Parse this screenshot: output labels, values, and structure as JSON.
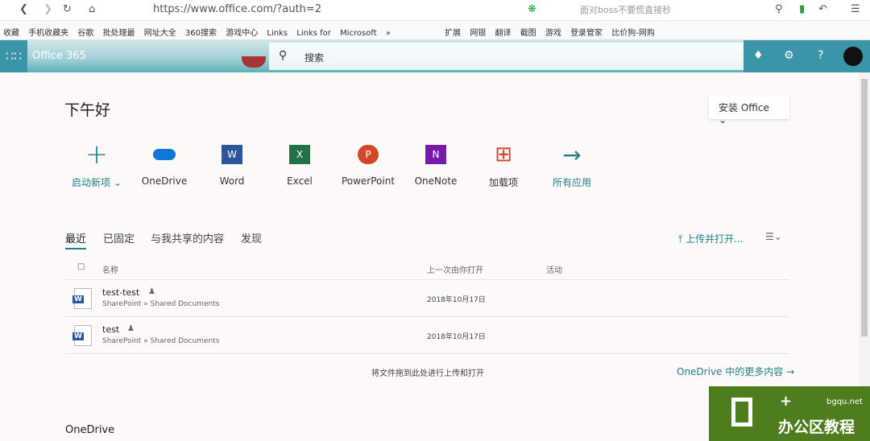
{
  "browser": {
    "url": "https://www.office.com/?auth=2",
    "search_placeholder": "面对boss不要慌直接秒",
    "bookmarks": [
      "收藏",
      "手机收藏夹",
      "谷歌",
      "批处理最",
      "网址大全",
      "360搜索",
      "游戏中心",
      "Links",
      "Links for",
      "Microsoft",
      "»",
      "扩展",
      "网银",
      "翻译",
      "截图",
      "游戏",
      "登录管家",
      "比价狗-网购"
    ]
  },
  "header": {
    "brand": "Office 365",
    "search_placeholder": "搜索"
  },
  "main": {
    "greeting": "下午好",
    "install_label": "安装 Office",
    "apps": [
      {
        "label": "启动新项",
        "color": "#217f8c"
      },
      {
        "label": "OneDrive",
        "color": "#0f78d4"
      },
      {
        "label": "Word",
        "color": "#2b579a"
      },
      {
        "label": "Excel",
        "color": "#217346"
      },
      {
        "label": "PowerPoint",
        "color": "#d24726"
      },
      {
        "label": "OneNote",
        "color": "#7719aa"
      },
      {
        "label": "加载项",
        "color": "#d24726"
      },
      {
        "label": "所有应用",
        "color": "#217f8c"
      }
    ],
    "tabs": [
      "最近",
      "已固定",
      "与我共享的内容",
      "发现"
    ],
    "upload_open": "上传并打开...",
    "columns": {
      "name": "名称",
      "last_opened": "上一次由你打开",
      "activity": "活动"
    },
    "files": [
      {
        "name": "test-test",
        "location": "SharePoint » Shared Documents",
        "date": "2018年10月17日"
      },
      {
        "name": "test",
        "location": "SharePoint » Shared Documents",
        "date": "2018年10月17日"
      }
    ],
    "drag_hint": "将文件拖到此处进行上传和打开",
    "more_onedrive": "OneDrive 中的更多内容",
    "section_onedrive": "OneDrive"
  },
  "watermark": {
    "site": "bgqu.net",
    "text": "办公区教程"
  }
}
